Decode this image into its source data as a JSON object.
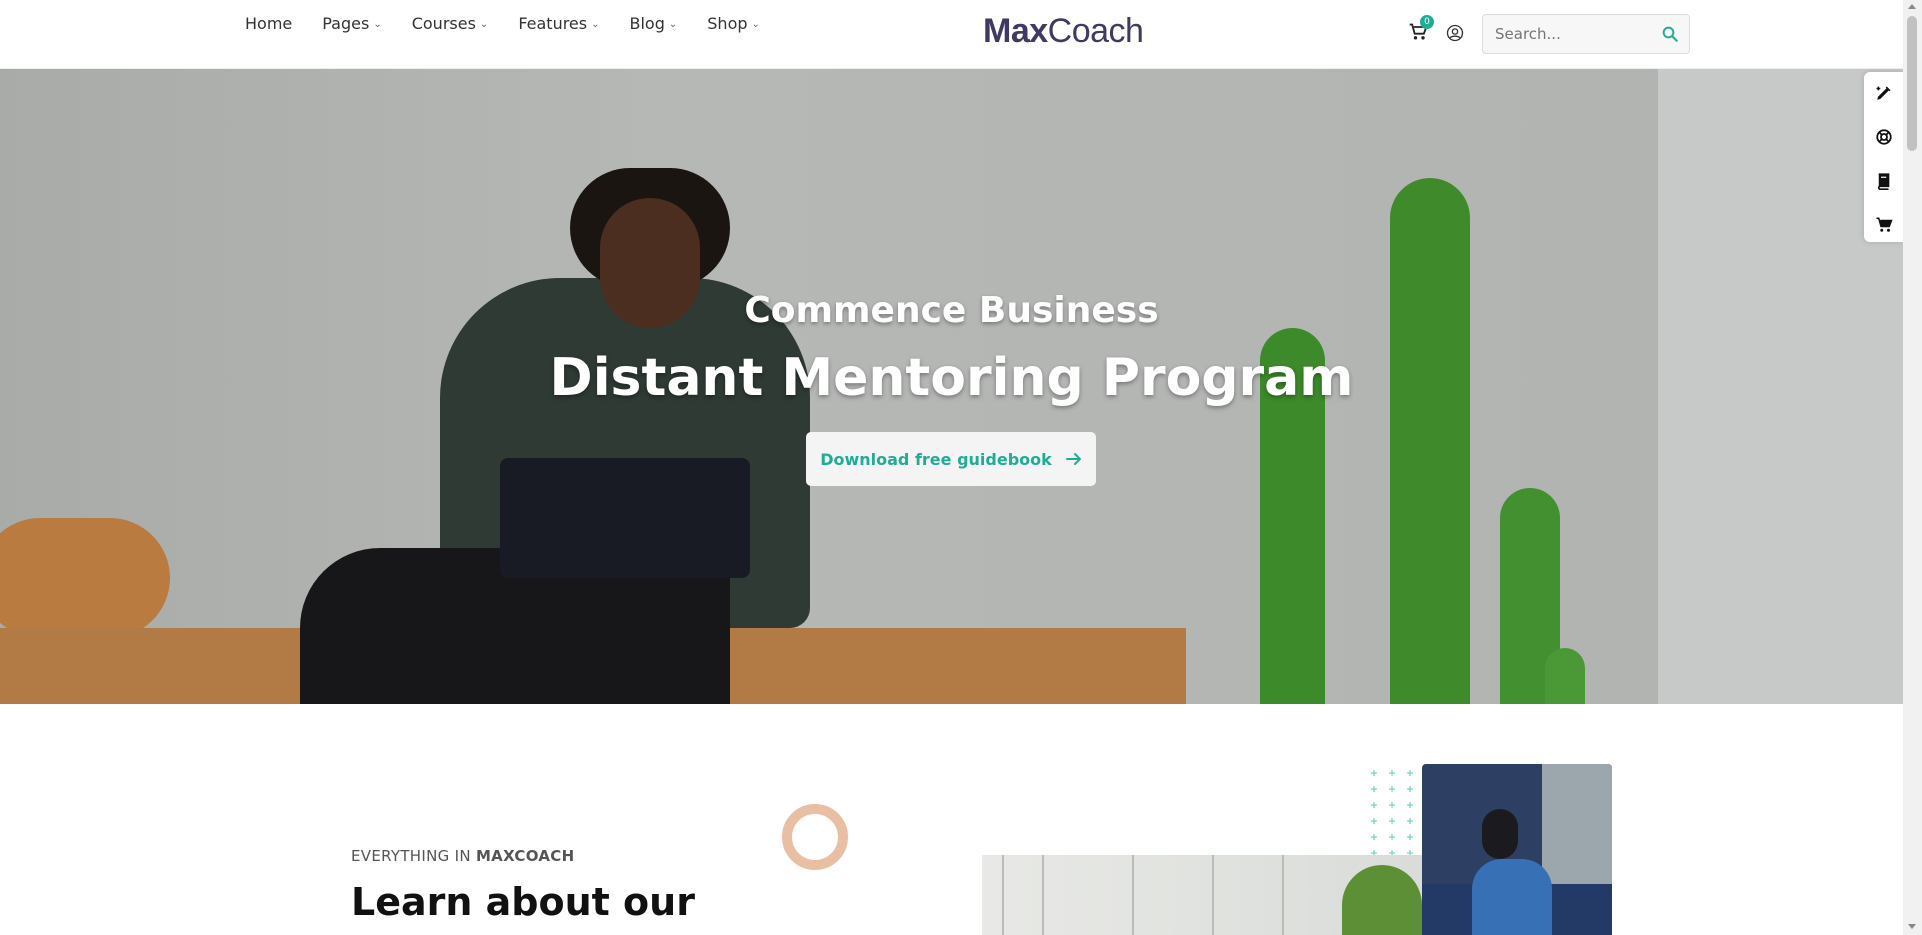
{
  "header": {
    "nav": [
      {
        "label": "Home",
        "has_dropdown": false
      },
      {
        "label": "Pages",
        "has_dropdown": true
      },
      {
        "label": "Courses",
        "has_dropdown": true
      },
      {
        "label": "Features",
        "has_dropdown": true
      },
      {
        "label": "Blog",
        "has_dropdown": true
      },
      {
        "label": "Shop",
        "has_dropdown": true
      }
    ],
    "logo": {
      "bold": "Max",
      "light": "Coach"
    },
    "cart_count": "0",
    "search": {
      "placeholder": "Search..."
    }
  },
  "hero": {
    "subtitle": "Commence Business",
    "title": "Distant Mentoring Program",
    "button_label": "Download free guidebook"
  },
  "section": {
    "eyebrow_prefix": "EVERYTHING IN",
    "eyebrow_brand": "MAXCOACH",
    "title": "Learn about our"
  },
  "side_toolbar": [
    "edit-icon",
    "lifebuoy-icon",
    "book-icon",
    "cart-icon"
  ],
  "colors": {
    "brand": "#3f3a64",
    "accent": "#20ad96",
    "ring": "#e9bfa4"
  }
}
